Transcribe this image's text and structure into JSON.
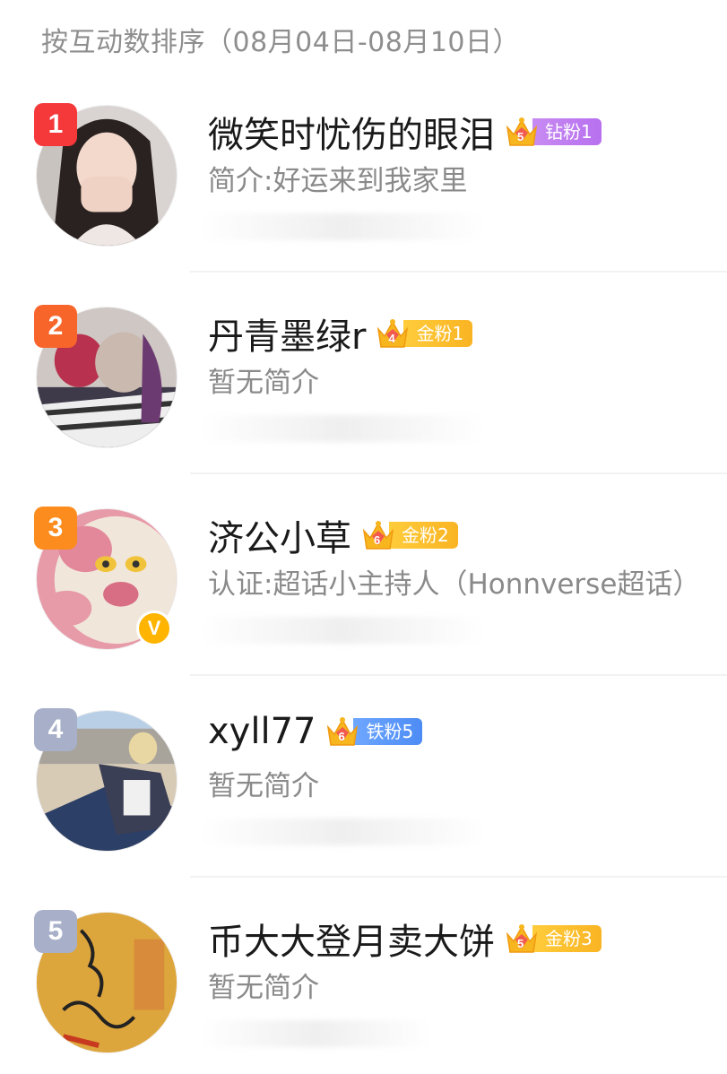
{
  "header": {
    "sort_label": "按互动数排序（08月04日-08月10日）"
  },
  "fans": [
    {
      "rank": "1",
      "name": "微笑时忧伤的眼泪",
      "level_badge": {
        "crown_level": "5",
        "label": "钻粉1",
        "type": "diamond"
      },
      "intro": "简介:好运来到我家里",
      "verified": false
    },
    {
      "rank": "2",
      "name": "丹青墨绿r",
      "level_badge": {
        "crown_level": "4",
        "label": "金粉1",
        "type": "gold"
      },
      "intro": "暂无简介",
      "verified": false
    },
    {
      "rank": "3",
      "name": "济公小草",
      "level_badge": {
        "crown_level": "6",
        "label": "金粉2",
        "type": "gold"
      },
      "intro": "认证:超话小主持人（Honnverse超话）",
      "verified": true,
      "verified_mark": "V"
    },
    {
      "rank": "4",
      "name": "xyll77",
      "level_badge": {
        "crown_level": "6",
        "label": "铁粉5",
        "type": "iron"
      },
      "intro": "暂无简介",
      "verified": false
    },
    {
      "rank": "5",
      "name": "币大大登月卖大饼",
      "level_badge": {
        "crown_level": "5",
        "label": "金粉3",
        "type": "gold"
      },
      "intro": "暂无简介",
      "verified": false
    }
  ],
  "colors": {
    "rank1": "#f5383a",
    "rank2": "#f7652b",
    "rank3": "#fb8c1d",
    "rank_other": "#a7afc9",
    "diamond_badge": "#b870ef",
    "gold_badge": "#f9b423",
    "iron_badge": "#4d8cf5",
    "verified": "#ffb400"
  }
}
